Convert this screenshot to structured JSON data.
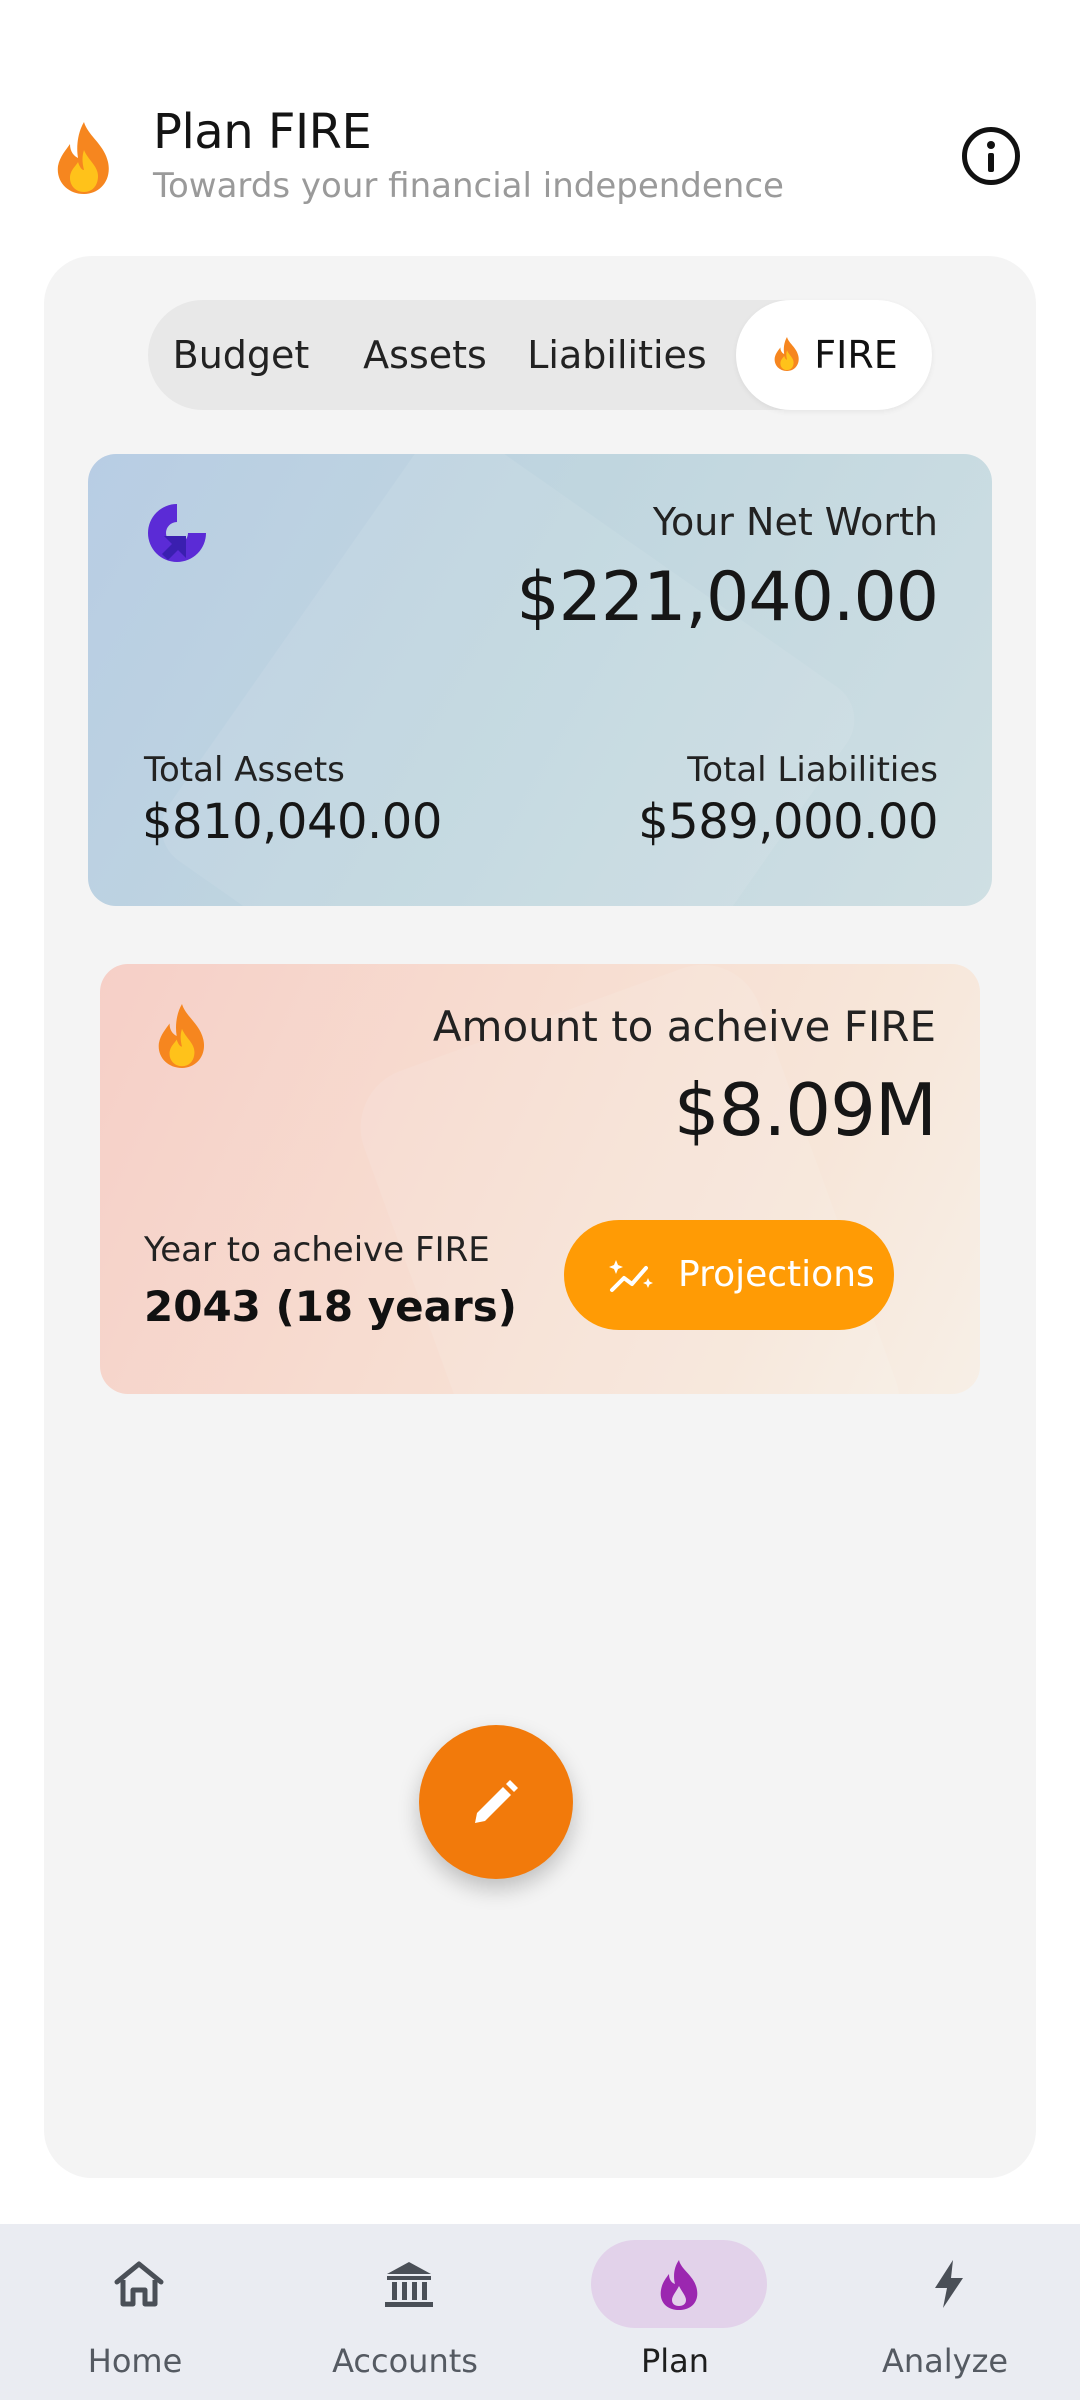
{
  "header": {
    "title": "Plan FIRE",
    "subtitle": "Towards your financial independence",
    "flame_icon": "fire-emoji",
    "info_icon": "info-icon"
  },
  "tabs": [
    {
      "label": "Budget",
      "active": false
    },
    {
      "label": "Assets",
      "active": false
    },
    {
      "label": "Liabilities",
      "active": false
    },
    {
      "label": "FIRE",
      "active": true,
      "icon": "fire-emoji"
    }
  ],
  "net_worth_card": {
    "label": "Your Net Worth",
    "value": "$221,040.00",
    "total_assets_label": "Total Assets",
    "total_assets_value": "$810,040.00",
    "total_liabilities_label": "Total Liabilities",
    "total_liabilities_value": "$589,000.00",
    "logo_color": "#5b2bd6"
  },
  "fire_card": {
    "label": "Amount to acheive FIRE",
    "value": "$8.09M",
    "year_label": "Year to acheive FIRE",
    "year_value": "2043 (18 years)",
    "projections_label": "Projections",
    "button_color": "#ff9b05"
  },
  "fab": {
    "icon": "pencil-icon",
    "color": "#f27a0b"
  },
  "bottom_nav": [
    {
      "label": "Home",
      "icon": "home-icon",
      "active": false
    },
    {
      "label": "Accounts",
      "icon": "bank-icon",
      "active": false
    },
    {
      "label": "Plan",
      "icon": "flame-icon",
      "active": true
    },
    {
      "label": "Analyze",
      "icon": "bolt-icon",
      "active": false
    }
  ]
}
